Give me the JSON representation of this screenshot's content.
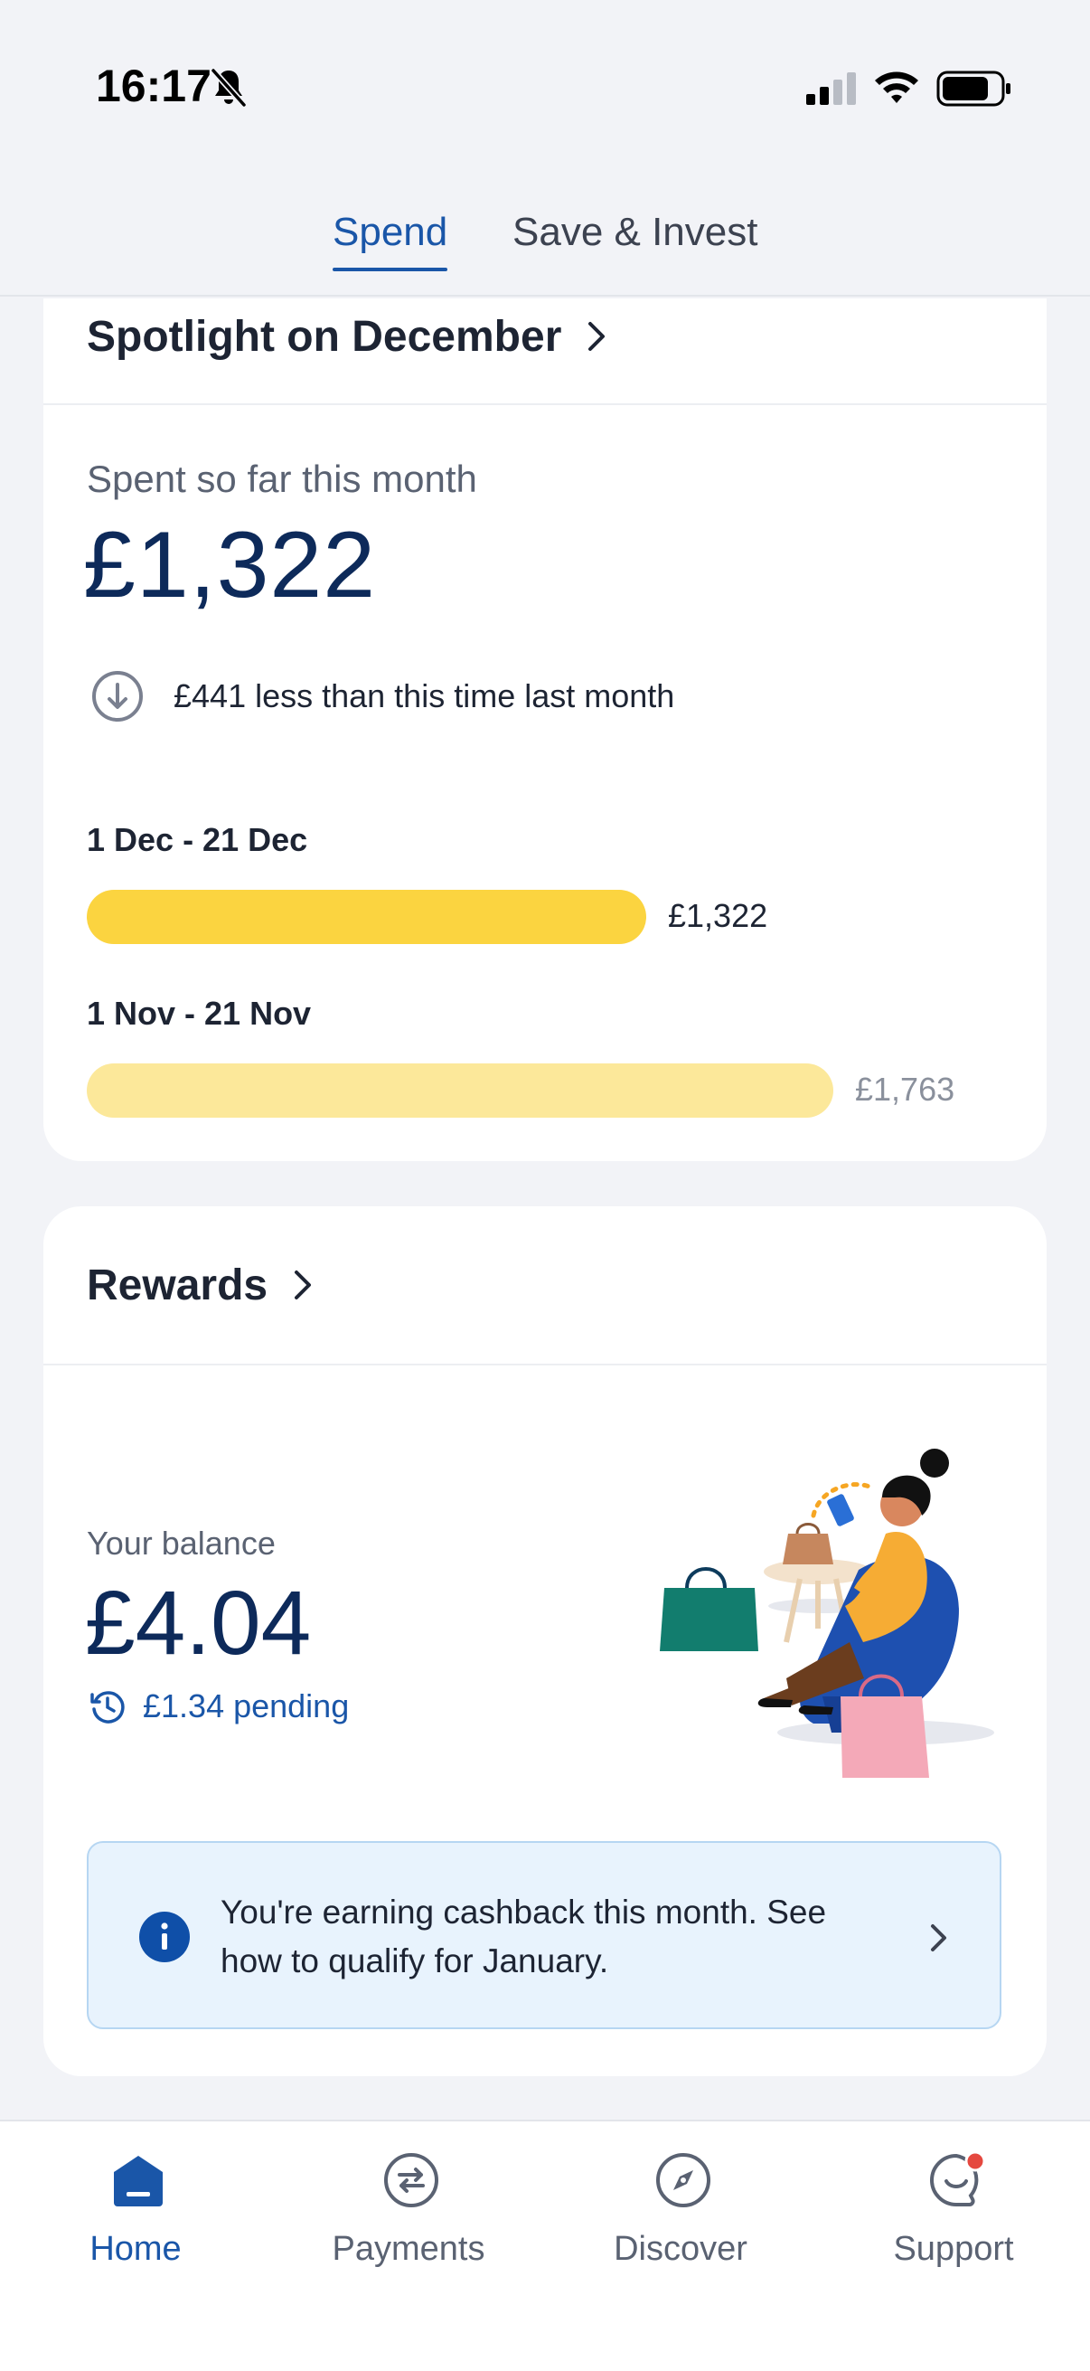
{
  "status_bar": {
    "time": "16:17"
  },
  "tabs": [
    {
      "label": "Spend",
      "active": true
    },
    {
      "label": "Save & Invest",
      "active": false
    }
  ],
  "spotlight": {
    "title": "Spotlight on December",
    "spent_label": "Spent so far this month",
    "spent_amount": "£1,322",
    "delta_text": "£441 less than this time last month",
    "periods": [
      {
        "label": "1 Dec - 21 Dec",
        "value_text": "£1,322",
        "value": 1322,
        "color": "#fbd440"
      },
      {
        "label": "1 Nov - 21 Nov",
        "value_text": "£1,763",
        "value": 1763,
        "color": "#fce89a"
      }
    ]
  },
  "rewards": {
    "title": "Rewards",
    "balance_label": "Your balance",
    "balance_amount": "£4.04",
    "pending_text": "£1.34 pending",
    "info_text": "You're earning cashback this month. See how to qualify for January."
  },
  "bottom_nav": [
    {
      "label": "Home",
      "icon": "home-icon",
      "active": true
    },
    {
      "label": "Payments",
      "icon": "transfer-icon",
      "active": false
    },
    {
      "label": "Discover",
      "icon": "compass-icon",
      "active": false
    },
    {
      "label": "Support",
      "icon": "chat-icon",
      "active": false,
      "notification": true
    }
  ],
  "colors": {
    "accent": "#1a56a8",
    "amount": "#0d2a5a",
    "bar_current": "#fbd440",
    "bar_previous": "#fce89a",
    "notification_dot": "#e5483f"
  }
}
